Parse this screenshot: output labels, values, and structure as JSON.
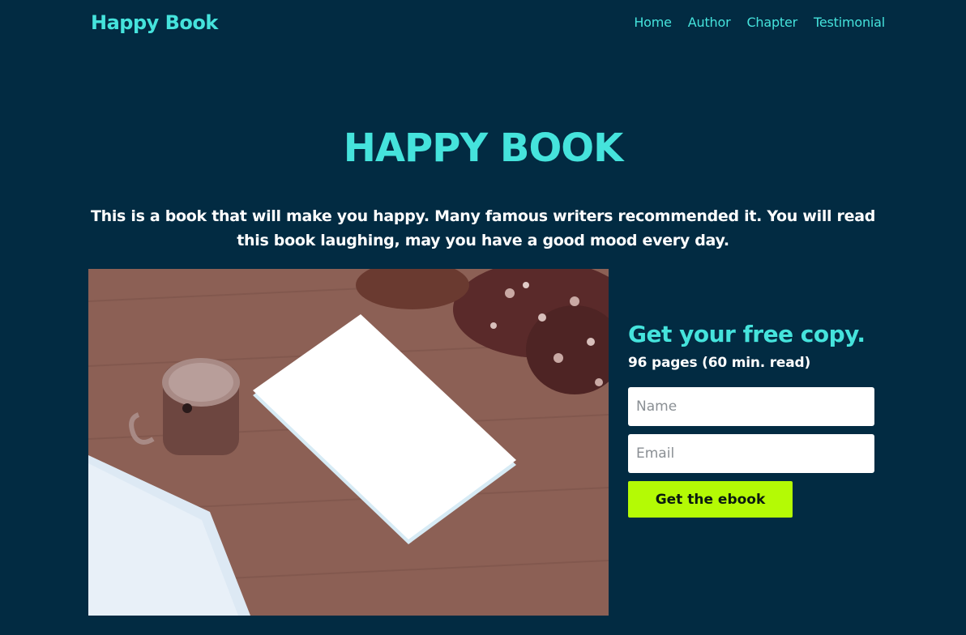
{
  "nav": {
    "brand": "Happy Book",
    "links": [
      "Home",
      "Author",
      "Chapter",
      "Testimonial"
    ]
  },
  "hero": {
    "title": "HAPPY BOOK",
    "description": "This is a book that will make you happy. Many famous writers recommended it. You will read this book laughing, may you have a good mood every day."
  },
  "signup": {
    "heading": "Get your free copy.",
    "pages_info": "96 pages (60 min. read)",
    "name_placeholder": "Name",
    "email_placeholder": "Email",
    "button_label": "Get the ebook"
  },
  "colors": {
    "background": "#022b42",
    "accent": "#45e3dc",
    "button": "#b4fa05"
  }
}
